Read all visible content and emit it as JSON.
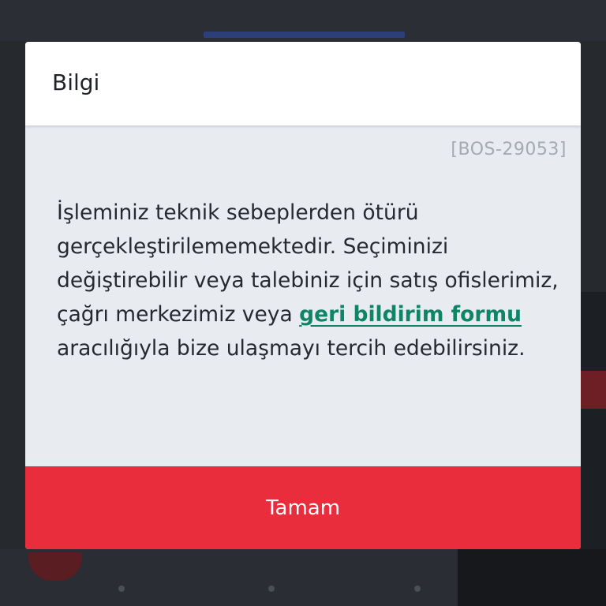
{
  "dialog": {
    "title": "Bilgi",
    "error_code": "[BOS-29053]",
    "message_before_link": "İşleminiz teknik sebeplerden ötürü gerçekleştirilememektedir. Seçiminizi değiştirebilir veya talebiniz için satış ofislerimiz, çağrı merkezimiz veya ",
    "link_text": "geri bildirim formu",
    "message_after_link": " aracılığıyla bize ulaşmayı tercih edebilirsiniz.",
    "confirm_label": "Tamam"
  },
  "colors": {
    "link": "#0f8466",
    "confirm_button": "#e92d3c",
    "dialog_body": "#e8ecf1",
    "overlay": "#262a2f"
  }
}
